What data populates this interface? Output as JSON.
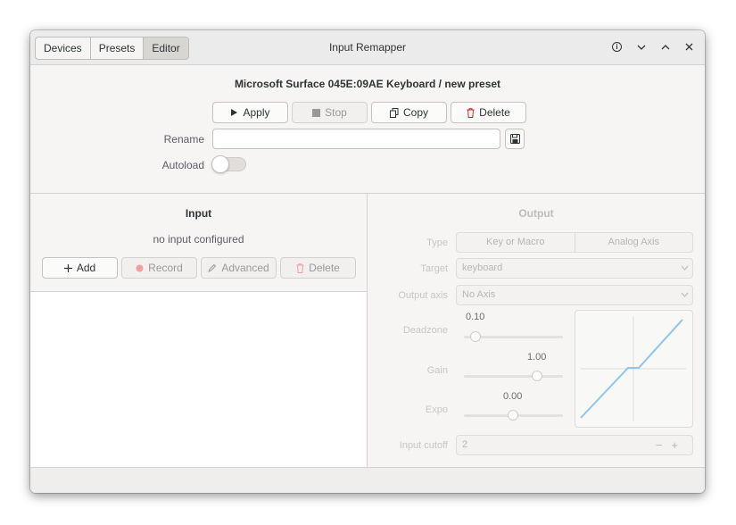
{
  "window": {
    "title": "Input Remapper",
    "tabs": [
      {
        "label": "Devices",
        "active": false
      },
      {
        "label": "Presets",
        "active": false
      },
      {
        "label": "Editor",
        "active": true
      }
    ]
  },
  "header": {
    "device_preset": "Microsoft Surface 045E:09AE Keyboard  /  new preset"
  },
  "toolbar": {
    "apply": "Apply",
    "stop": "Stop",
    "copy": "Copy",
    "delete": "Delete"
  },
  "rename": {
    "label": "Rename",
    "value": "",
    "placeholder": ""
  },
  "autoload": {
    "label": "Autoload",
    "enabled": false
  },
  "input": {
    "title": "Input",
    "empty_text": "no input configured",
    "add": "Add",
    "record": "Record",
    "advanced": "Advanced",
    "delete": "Delete"
  },
  "output": {
    "title": "Output",
    "type_label": "Type",
    "type_options": [
      "Key or Macro",
      "Analog Axis"
    ],
    "target_label": "Target",
    "target_value": "keyboard",
    "axis_label": "Output axis",
    "axis_value": "No Axis",
    "deadzone_label": "Deadzone",
    "deadzone_value": "0.10",
    "gain_label": "Gain",
    "gain_value": "1.00",
    "expo_label": "Expo",
    "expo_value": "0.00",
    "cutoff_label": "Input cutoff",
    "cutoff_value": "2"
  },
  "colors": {
    "accent_curve": "#8ec5ea",
    "delete_icon": "#e01b24",
    "record_dot": "#f0a0a0"
  }
}
